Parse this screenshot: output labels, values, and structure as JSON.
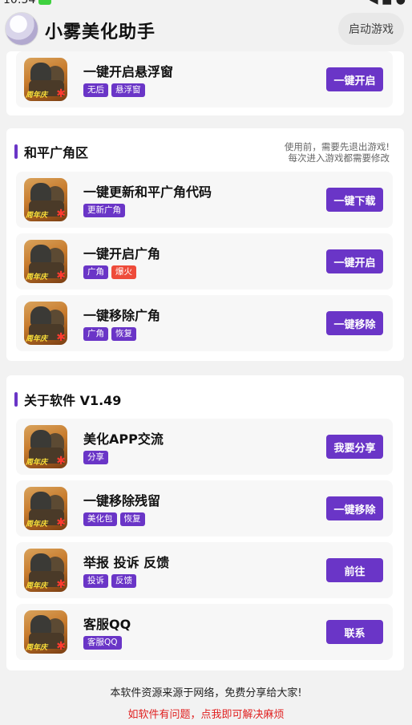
{
  "status": {
    "time": "10:54",
    "right": "◀ ■ ●"
  },
  "header": {
    "title": "小雾美化助手",
    "start_button": "启动游戏"
  },
  "icon_label": "周年庆",
  "section1": {
    "items": [
      {
        "title": "一键开启悬浮窗",
        "tags": [
          "无后",
          "悬浮窗"
        ],
        "tag_colors": [
          "purple",
          "purple"
        ],
        "button": "一键开启"
      }
    ]
  },
  "section2": {
    "title": "和平广角区",
    "note_line1": "使用前，需要先退出游戏!",
    "note_line2": "每次进入游戏都需要修改",
    "items": [
      {
        "title": "一键更新和平广角代码",
        "tags": [
          "更新广角"
        ],
        "tag_colors": [
          "purple"
        ],
        "button": "一键下载"
      },
      {
        "title": "一键开启广角",
        "tags": [
          "广角",
          "爆火"
        ],
        "tag_colors": [
          "purple",
          "red"
        ],
        "button": "一键开启"
      },
      {
        "title": "一键移除广角",
        "tags": [
          "广角",
          "恢复"
        ],
        "tag_colors": [
          "purple",
          "purple"
        ],
        "button": "一键移除"
      }
    ]
  },
  "section3": {
    "title": "关于软件 V1.49",
    "items": [
      {
        "title": "美化APP交流",
        "tags": [
          "分享"
        ],
        "tag_colors": [
          "purple"
        ],
        "button": "我要分享"
      },
      {
        "title": "一键移除残留",
        "tags": [
          "美化包",
          "恢复"
        ],
        "tag_colors": [
          "purple",
          "purple"
        ],
        "button": "一键移除"
      },
      {
        "title": "举报 投诉 反馈",
        "tags": [
          "投诉",
          "反馈"
        ],
        "tag_colors": [
          "purple",
          "purple"
        ],
        "button": "前往"
      },
      {
        "title": "客服QQ",
        "tags": [
          "客服QQ"
        ],
        "tag_colors": [
          "purple"
        ],
        "button": "联系"
      }
    ]
  },
  "footer": {
    "line1": "本软件资源来源于网络，免费分享给大家!",
    "line2": "如软件有问题，点我即可解决麻烦"
  },
  "colors": {
    "accent": "#6a35c7",
    "hot": "#ee4b3a",
    "footer_link": "#e02020"
  }
}
